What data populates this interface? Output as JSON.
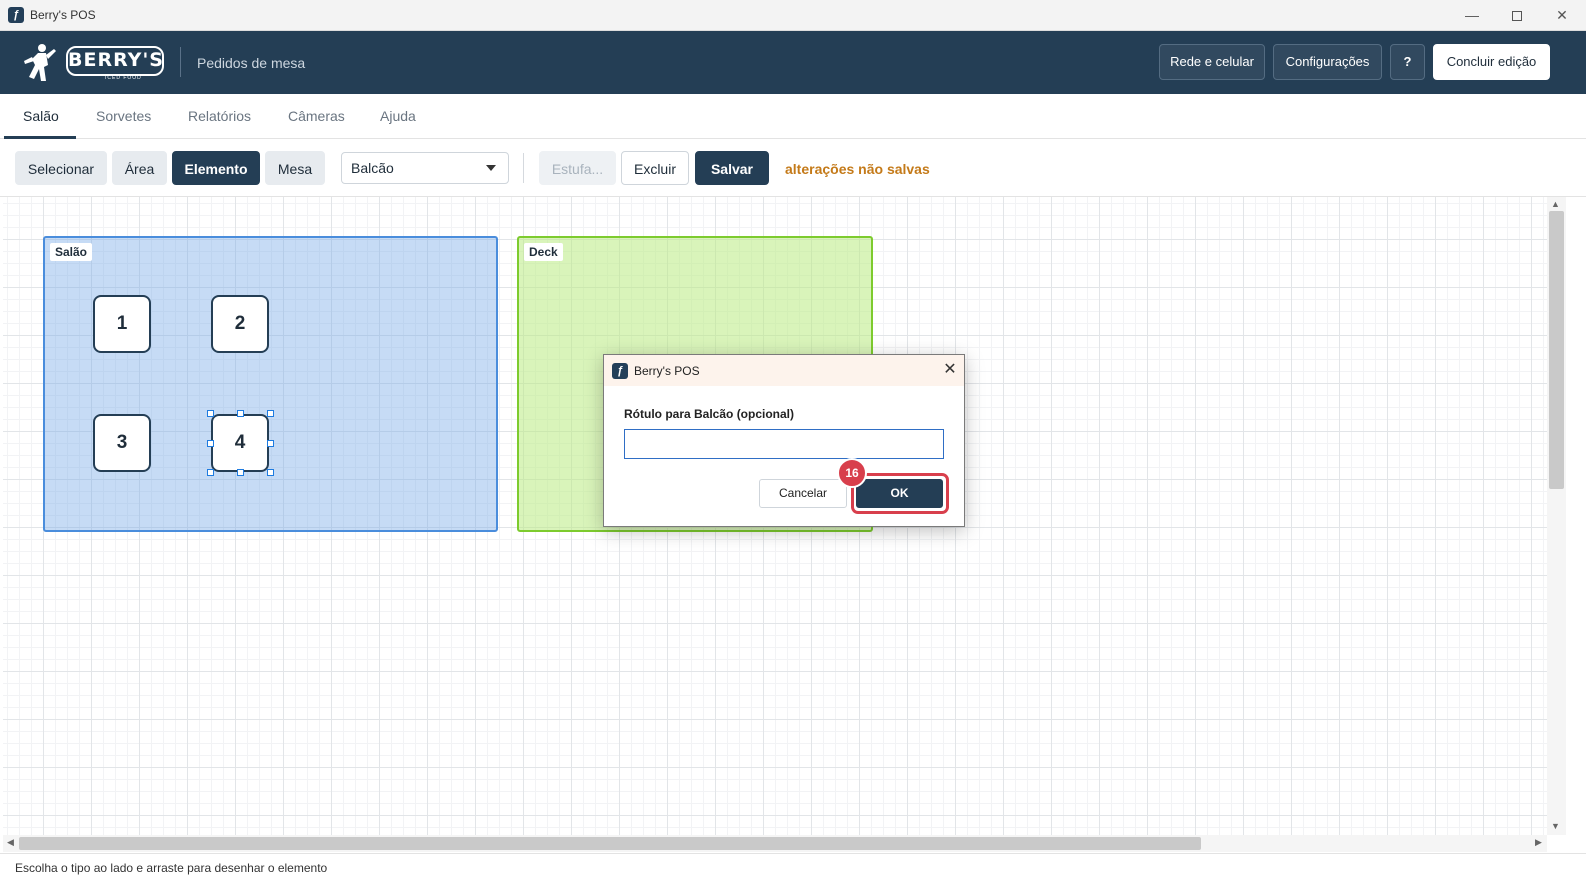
{
  "window": {
    "title": "Berry's POS",
    "controls": {
      "minimize": "—",
      "close": "✕"
    }
  },
  "header": {
    "logo_text": "BERRY'S",
    "logo_subtext": "ICED FOOD",
    "subtitle": "Pedidos de mesa",
    "buttons": {
      "network": "Rede e celular",
      "settings": "Configurações",
      "help": "?",
      "finish_edit": "Concluir edição"
    }
  },
  "tabs": [
    {
      "label": "Salão",
      "active": true
    },
    {
      "label": "Sorvetes",
      "active": false
    },
    {
      "label": "Relatórios",
      "active": false
    },
    {
      "label": "Câmeras",
      "active": false
    },
    {
      "label": "Ajuda",
      "active": false
    }
  ],
  "toolbar": {
    "modes": [
      {
        "label": "Selecionar",
        "active": false
      },
      {
        "label": "Área",
        "active": false
      },
      {
        "label": "Elemento",
        "active": true
      },
      {
        "label": "Mesa",
        "active": false
      }
    ],
    "element_type": {
      "selected": "Balcão"
    },
    "estufa_label": "Estufa...",
    "delete_label": "Excluir",
    "save_label": "Salvar",
    "unsaved_label": "alterações não salvas"
  },
  "canvas": {
    "areas": [
      {
        "name": "Salão",
        "color": "#4a8ddc"
      },
      {
        "name": "Deck",
        "color": "#7dcb2e"
      }
    ],
    "tables": [
      "1",
      "2",
      "3",
      "4"
    ],
    "selected_table": "4"
  },
  "status": {
    "text": "Escolha o tipo ao lado e arraste para desenhar o elemento"
  },
  "dialog": {
    "title": "Berry's POS",
    "close": "✕",
    "label": "Rótulo para Balcão (opcional)",
    "input_value": "",
    "cancel_label": "Cancelar",
    "ok_label": "OK",
    "step_badge": "16",
    "highlight_color": "#d83f4c"
  },
  "colors": {
    "brand": "#243e55",
    "warning": "#c47a19"
  }
}
